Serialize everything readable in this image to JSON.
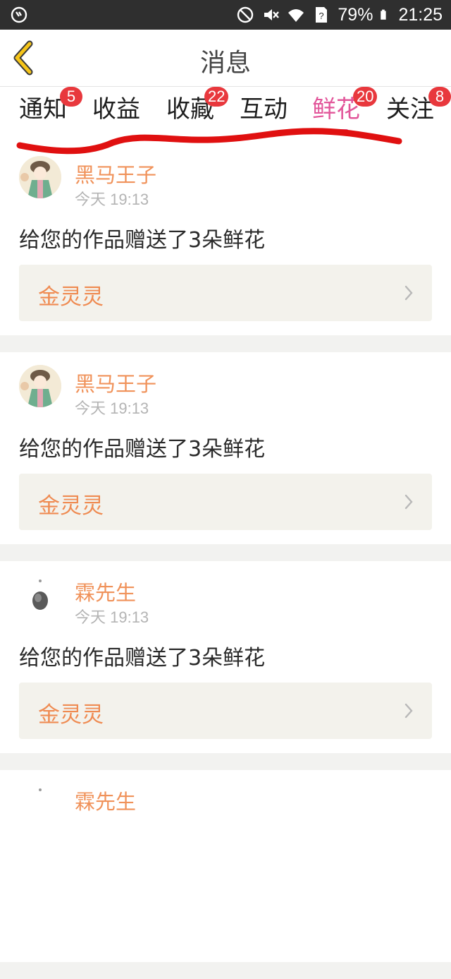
{
  "status_bar": {
    "battery": "79%",
    "time": "21:25",
    "icons": [
      "sync-icon",
      "no-disturb-icon",
      "mute-icon",
      "wifi-icon",
      "sim-unknown-icon",
      "battery-icon"
    ]
  },
  "header": {
    "title": "消息",
    "back_icon": "chevron-left-icon"
  },
  "tabs": [
    {
      "label": "通知",
      "badge": "5"
    },
    {
      "label": "收益",
      "badge": ""
    },
    {
      "label": "收藏",
      "badge": "22"
    },
    {
      "label": "互动",
      "badge": ""
    },
    {
      "label": "鲜花",
      "badge": "20",
      "active": true
    },
    {
      "label": "关注",
      "badge": "8"
    }
  ],
  "messages": [
    {
      "user": "黑马王子",
      "time": "今天 19:13",
      "text": "给您的作品赠送了3朵鲜花",
      "work": "金灵灵"
    },
    {
      "user": "黑马王子",
      "time": "今天 19:13",
      "text": "给您的作品赠送了3朵鲜花",
      "work": "金灵灵"
    },
    {
      "user": "霖先生",
      "time": "今天 19:13",
      "text": "给您的作品赠送了3朵鲜花",
      "work": "金灵灵"
    },
    {
      "user": "霖先生",
      "time": "",
      "text": "",
      "work": ""
    }
  ],
  "colors": {
    "accent": "#e2569a",
    "badge": "#e8383d",
    "username": "#f0925a",
    "annotation": "#e01010"
  }
}
